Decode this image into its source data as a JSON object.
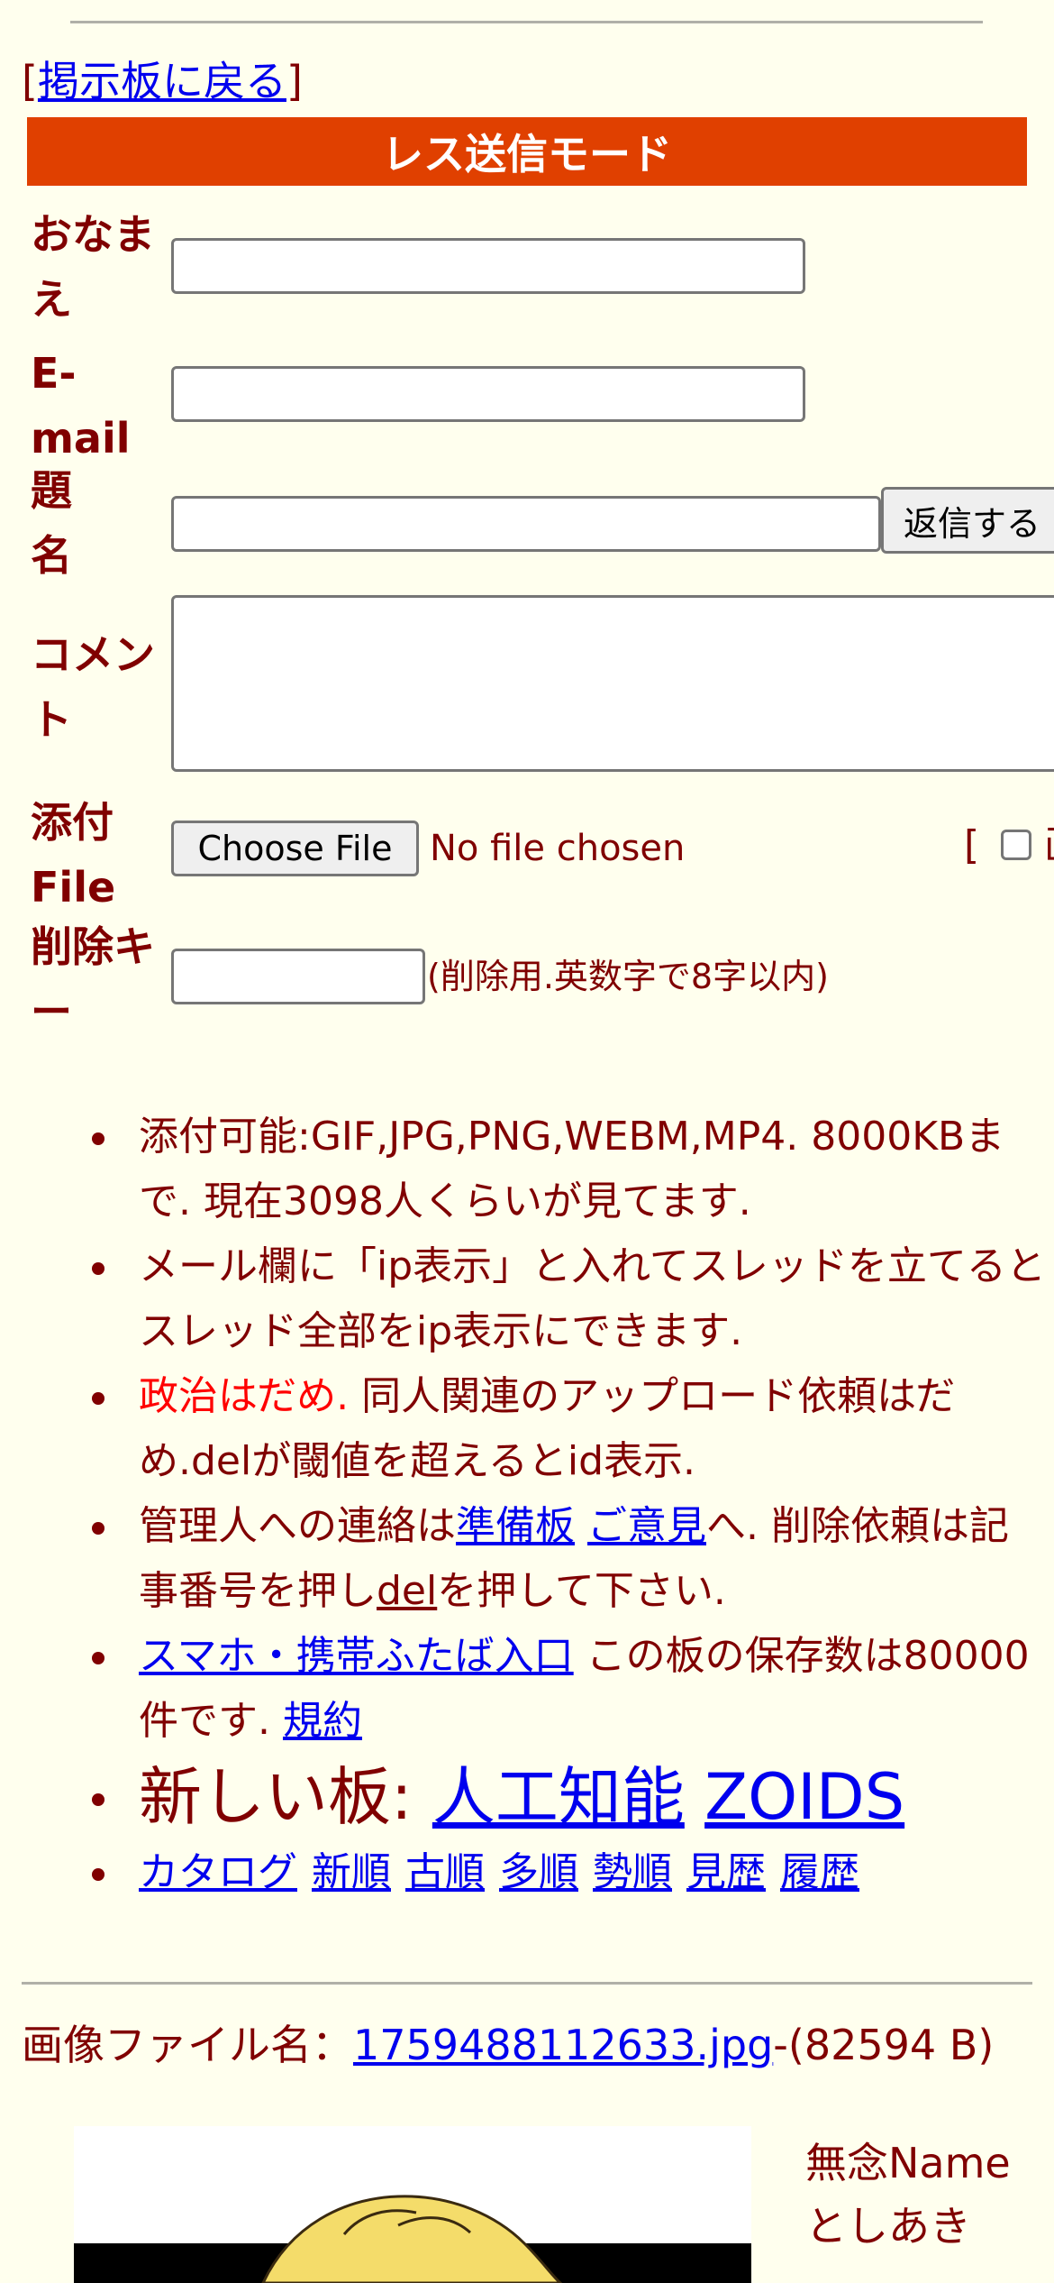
{
  "back_link": {
    "open": "[",
    "label": "掲示板に戻る",
    "close": "]"
  },
  "mode_banner": "レス送信モード",
  "form": {
    "name_label": "おなまえ",
    "email_label": "E-mail",
    "subject_label": "題名",
    "submit_label": "返信する",
    "comment_label": "コメント",
    "file_label": "添付File",
    "choose_file_label": "Choose File",
    "no_file_text": "No file chosen",
    "image_option_prefix": "[",
    "image_option_label": "画",
    "delete_key_label": "削除キー",
    "delete_key_hint": "(削除用.英数字で8字以内)"
  },
  "notices": {
    "item1": "添付可能:GIF,JPG,PNG,WEBM,MP4. 8000KBまで. 現在3098人くらいが見てます.",
    "item2": "メール欄に「ip表示」と入れてスレッドを立てるとスレッド全部をip表示にできます.",
    "item3_red": "政治はだめ.",
    "item3_rest": " 同人関連のアップロード依頼はだめ.delが閾値を超えるとid表示.",
    "item4_a": "管理人への連絡は",
    "item4_link1": "準備板",
    "item4_link2": "ご意見",
    "item4_b": "へ. 削除依頼は記事番号を押し",
    "item4_link3": "del",
    "item4_c": "を押して下さい.",
    "item5_link": "スマホ・携帯ふたば入口",
    "item5_text": " この板の保存数は80000件です. ",
    "item5_link2": "規約",
    "item6_text": "新しい板: ",
    "item6_link1": "人工知能",
    "item6_link2": "ZOIDS",
    "catalog_links": [
      "カタログ",
      "新順",
      "古順",
      "多順",
      "勢順",
      "見歴",
      "履歴"
    ]
  },
  "post": {
    "file_label": "画像ファイル名：",
    "file_link": "1759488112633.jpg",
    "file_size": "-(82594 B)",
    "name": "無念Name",
    "user": "としあき"
  },
  "colors": {
    "banner": "#e04000",
    "background": "#ffffee",
    "text": "#800000",
    "link": "#0000ee",
    "warning": "#ff0000"
  }
}
